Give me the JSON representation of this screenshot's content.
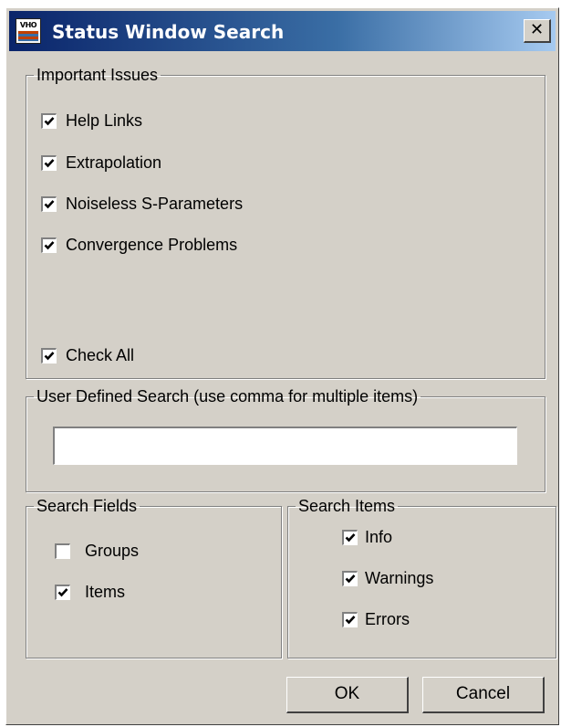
{
  "window": {
    "title": "Status Window Search",
    "app_icon_text": "VHO",
    "close_symbol": "✕"
  },
  "important_issues": {
    "legend": "Important Issues",
    "items": [
      {
        "label": "Help Links",
        "checked": true
      },
      {
        "label": "Extrapolation",
        "checked": true
      },
      {
        "label": "Noiseless S-Parameters",
        "checked": true
      },
      {
        "label": "Convergence Problems",
        "checked": true
      }
    ],
    "check_all": {
      "label": "Check All",
      "checked": true
    }
  },
  "user_defined_search": {
    "legend": "User Defined Search (use comma for multiple items)",
    "value": "",
    "placeholder": ""
  },
  "search_fields": {
    "legend": "Search Fields",
    "items": [
      {
        "label": "Groups",
        "checked": false
      },
      {
        "label": "Items",
        "checked": true
      }
    ]
  },
  "search_items": {
    "legend": "Search Items",
    "items": [
      {
        "label": "Info",
        "checked": true
      },
      {
        "label": "Warnings",
        "checked": true
      },
      {
        "label": "Errors",
        "checked": true
      }
    ]
  },
  "buttons": {
    "ok": "OK",
    "cancel": "Cancel"
  },
  "colors": {
    "face": "#d4d0c8",
    "titlebar_start": "#0a246a",
    "titlebar_end": "#a6caf0"
  },
  "icons": {
    "app": "vho-app-icon",
    "close": "close-icon",
    "checkmark": "checkmark-icon"
  }
}
